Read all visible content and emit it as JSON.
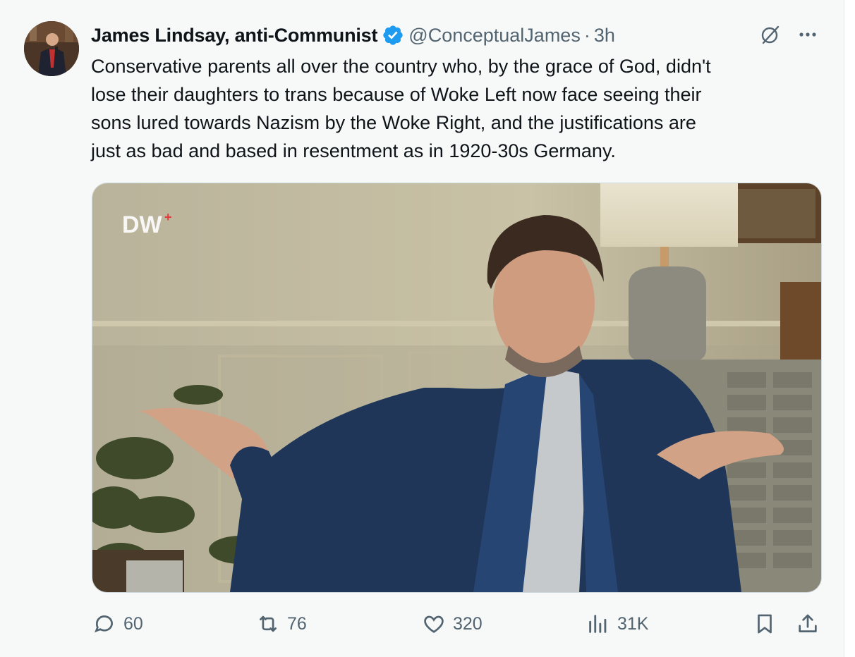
{
  "author": {
    "name": "James Lindsay, anti-Communist",
    "handle": "@ConceptualJames",
    "time": "3h",
    "verified": true
  },
  "tweet": {
    "lines": [
      "Conservative parents all over the country who, by the grace of God, didn't",
      "lose their daughters to trans because of Woke Left now face seeing their",
      "sons lured towards Nazism by the Woke Right, and the justifications are",
      "just as bad and based in resentment as in 1920-30s Germany."
    ]
  },
  "media": {
    "logo_text": "DW"
  },
  "actions": {
    "replies": "60",
    "reposts": "76",
    "likes": "320",
    "views": "31K"
  },
  "colors": {
    "verified": "#1d9bf0",
    "muted": "#536471",
    "text": "#0f1419"
  },
  "icons": [
    "grok-icon",
    "more-icon",
    "reply-icon",
    "repost-icon",
    "like-icon",
    "views-icon",
    "bookmark-icon",
    "share-icon"
  ]
}
